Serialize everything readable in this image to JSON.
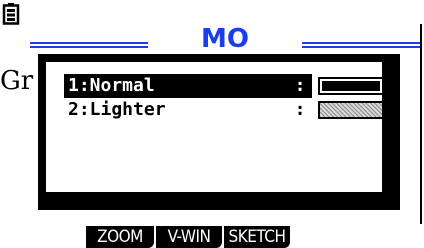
{
  "header": {
    "title": "MO"
  },
  "background": {
    "label": "Gr"
  },
  "dialog": {
    "options": [
      {
        "label": "1:Normal",
        "separator": ":",
        "swatch": "solid"
      },
      {
        "label": "2:Lighter",
        "separator": ":",
        "swatch": "shaded"
      }
    ],
    "selected_index": 0
  },
  "function_keys": [
    "ZOOM",
    "V-WIN",
    "SKETCH"
  ],
  "colors": {
    "title": "#1a3df0",
    "highlight": "#000000",
    "background": "#ffffff"
  }
}
